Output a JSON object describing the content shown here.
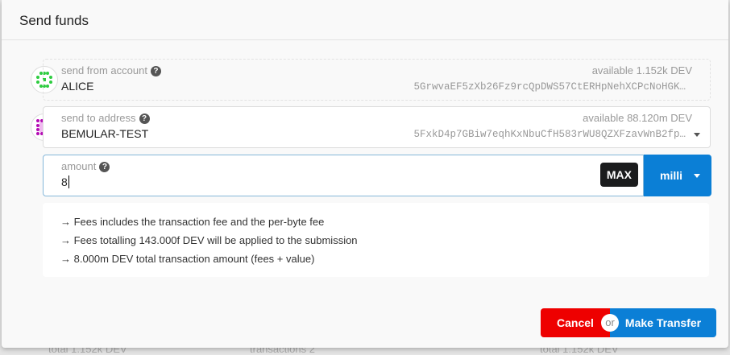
{
  "modal": {
    "title": "Send funds"
  },
  "from": {
    "label": "send from account",
    "help": "?",
    "name": "ALICE",
    "available": "available 1.152k DEV",
    "address": "5GrwvaEF5zXb26Fz9rcQpDWS57CtERHpNehXCPcNoHGK…"
  },
  "to": {
    "label": "send to address",
    "help": "?",
    "name": "BEMULAR-TEST",
    "available": "available 88.120m DEV",
    "address": "5FxkD4p7GBiw7eqhKxNbuCfH583rWU8QZXFzavWnB2fp…"
  },
  "amount": {
    "label": "amount",
    "help": "?",
    "value": "8",
    "max_label": "MAX",
    "unit": "milli"
  },
  "info": [
    "→ Fees includes the transaction fee and the per-byte fee",
    "→ Fees totalling 143.000f DEV will be applied to the submission",
    "→ 8.000m DEV total transaction amount (fees + value)"
  ],
  "actions": {
    "cancel": "Cancel",
    "or": "or",
    "submit": "Make Transfer"
  },
  "background": {
    "total1": "total 1.152k DEV",
    "transactions": "transactions 2",
    "total2": "total 1.152k DEV"
  },
  "colors": {
    "primary": "#0b7fd6",
    "danger": "#ee0000"
  }
}
